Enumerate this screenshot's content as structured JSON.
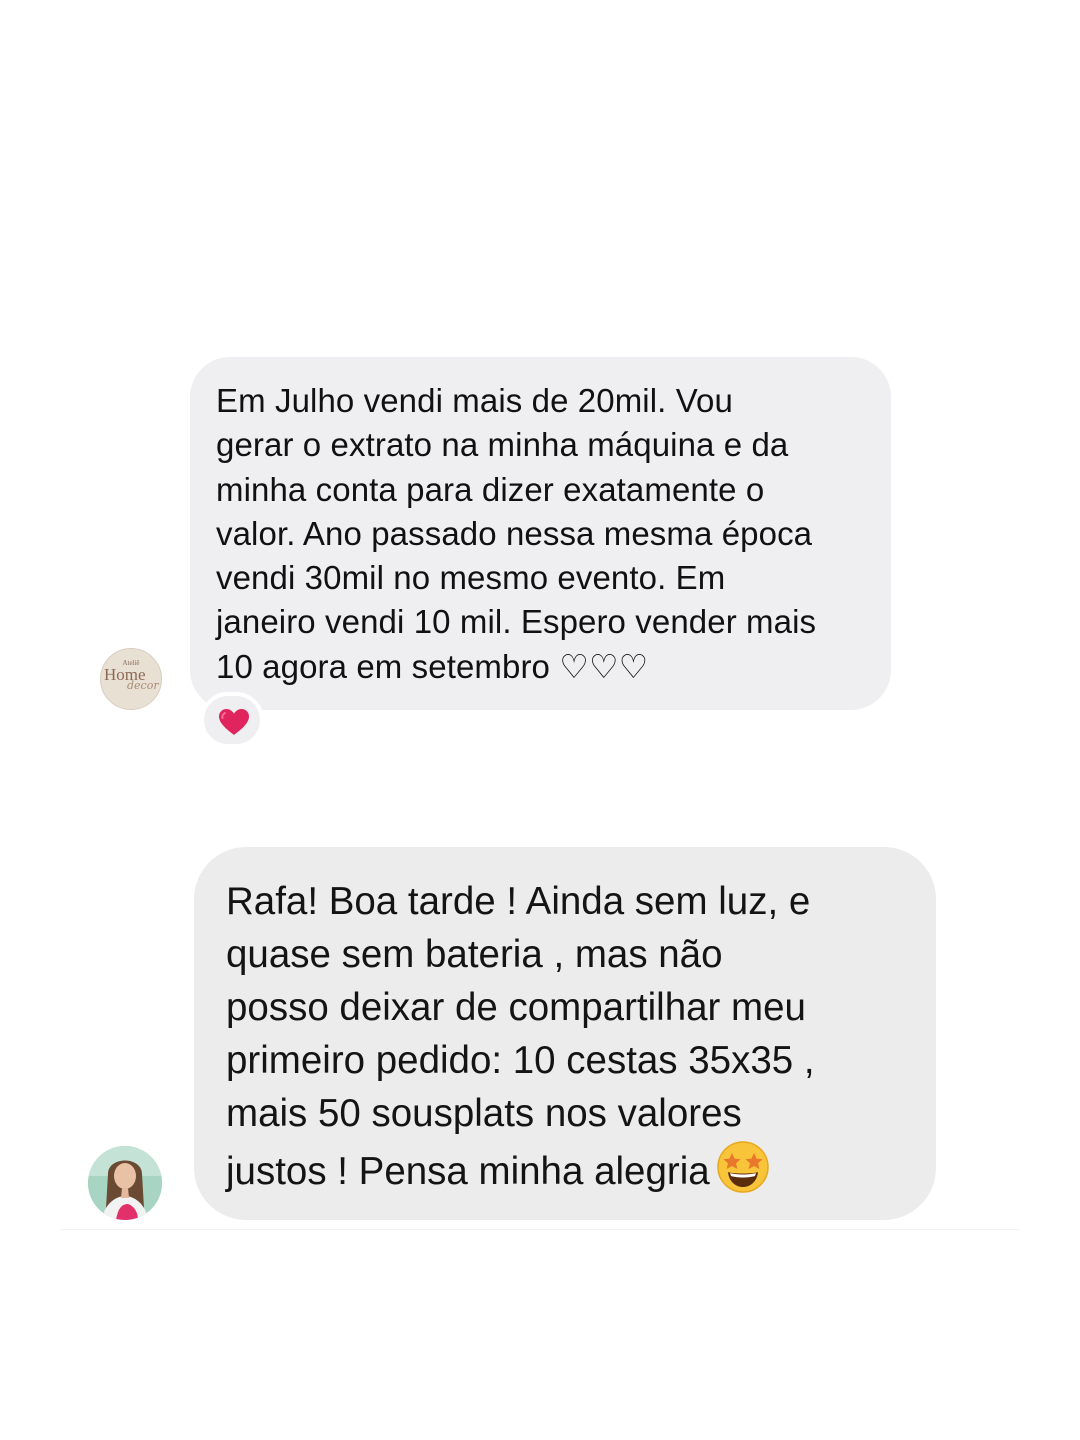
{
  "messages": [
    {
      "sender_avatar": "home-decor-logo-avatar",
      "avatar_text": {
        "small": "Ateliê",
        "main": "Home",
        "script": "decor"
      },
      "lines": [
        "Em Julho vendi mais de 20mil. Vou",
        "gerar o extrato na minha máquina e da",
        "minha conta para dizer exatamente o",
        "valor. Ano passado nessa mesma época",
        "vendi 30mil no mesmo evento. Em",
        "janeiro vendi 10 mil. Espero vender mais",
        "10 agora em setembro ♡♡♡"
      ],
      "reaction": "red-heart-icon"
    },
    {
      "sender_avatar": "woman-photo-avatar",
      "lines": [
        "Rafa! Boa tarde ! Ainda sem luz, e",
        "quase sem bateria , mas não",
        "posso deixar de compartilhar meu",
        "primeiro pedido: 10 cestas 35x35 ,",
        "mais 50 sousplats nos valores",
        "justos ! Pensa minha alegria"
      ],
      "trailing_emoji": "star-struck-emoji-icon"
    }
  ],
  "colors": {
    "bubble": "#efeff1",
    "bubble_screenshot": "#ececec",
    "text": "#111111",
    "heart": "#e0245e"
  }
}
